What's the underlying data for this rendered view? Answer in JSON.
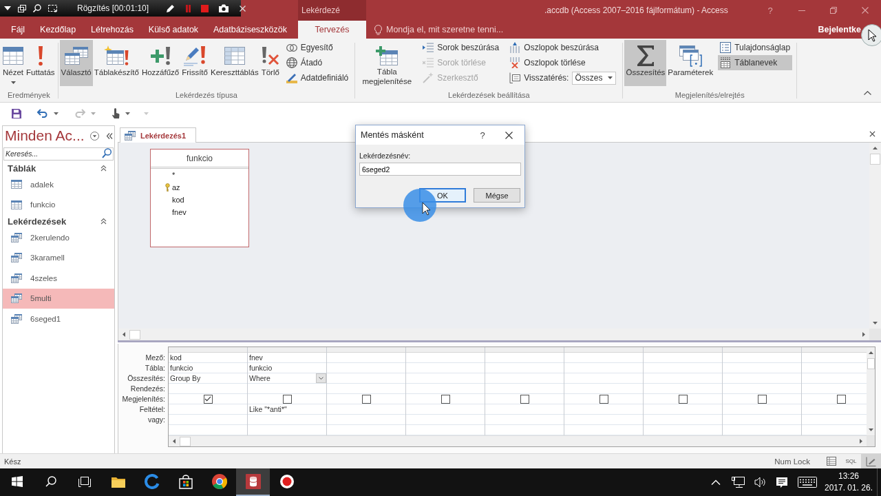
{
  "recorder_toolbar": {
    "status": "Rögzítés [00:01:10]"
  },
  "title_bar": {
    "title": ".accdb (Access 2007–2016 fájlformátum) - Access",
    "help": "?"
  },
  "ribbon_tabs": [
    {
      "label": "Fájl",
      "selected": false
    },
    {
      "label": "Kezdőlap",
      "selected": false
    },
    {
      "label": "Létrehozás",
      "selected": false
    },
    {
      "label": "Külső adatok",
      "selected": false
    },
    {
      "label": "Adatbáziseszközök",
      "selected": false
    }
  ],
  "context_group": {
    "label": "Lekérdezé",
    "tabs": [
      {
        "label": "Tervezés",
        "selected": true
      }
    ]
  },
  "tell_me": {
    "placeholder": "Mondja el, mit szeretne tenni..."
  },
  "account": "Bejelentke",
  "ribbon_groups": [
    {
      "label": "Eredmények",
      "buttons": [
        {
          "label": "Nézet",
          "selected": false,
          "dropdown": true
        },
        {
          "label": "Futtatás",
          "selected": false
        }
      ]
    },
    {
      "label": "Lekérdezés típusa",
      "buttons": [
        {
          "label": "Választó",
          "selected": true
        },
        {
          "label": "Táblakészítő",
          "selected": false
        },
        {
          "label": "Hozzáfűző",
          "selected": false
        },
        {
          "label": "Frissítő",
          "selected": false
        },
        {
          "label": "Kereszttáblás",
          "selected": false
        },
        {
          "label": "Törlő",
          "selected": false
        }
      ],
      "small_columns": [
        [
          {
            "kind": "button",
            "label": "Egyesítő"
          },
          {
            "kind": "button",
            "label": "Átadó"
          },
          {
            "kind": "button",
            "label": "Adatdefiniáló"
          }
        ]
      ]
    },
    {
      "label": "Lekérdezések beállítása",
      "buttons": [
        {
          "label": "Tábla megjelenítése",
          "selected": false
        }
      ],
      "small_columns": [
        [
          {
            "kind": "button",
            "label": "Sorok beszúrása",
            "disabled": false
          },
          {
            "kind": "button",
            "label": "Sorok törlése",
            "disabled": true
          },
          {
            "kind": "button",
            "label": "Szerkesztő",
            "disabled": true
          }
        ],
        [
          {
            "kind": "button",
            "label": "Oszlopok beszúrása",
            "disabled": false
          },
          {
            "kind": "button",
            "label": "Oszlopok törlése",
            "disabled": false
          },
          {
            "kind": "combo",
            "label": "Visszatérés:",
            "value": "Összes"
          }
        ]
      ]
    },
    {
      "label": "Megjelenítés/elrejtés",
      "buttons": [
        {
          "label": "Összesítés",
          "selected": true
        },
        {
          "label": "Paraméterek",
          "selected": false
        }
      ],
      "small_columns": [
        [
          {
            "kind": "button",
            "label": "Tulajdonságlap",
            "selected": false
          },
          {
            "kind": "button",
            "label": "Táblanevek",
            "selected": true
          }
        ]
      ]
    }
  ],
  "quick_access": [
    {
      "disabled": false
    },
    {
      "disabled": false
    },
    {
      "disabled": true
    },
    {
      "disabled": false
    }
  ],
  "nav_pane": {
    "title": "Minden Ac...",
    "search": {
      "placeholder": "Keresés..."
    },
    "groups": [
      {
        "label": "Táblák",
        "kind": "table",
        "expanded": true,
        "items": [
          {
            "label": "adalek",
            "selected": false
          },
          {
            "label": "funkcio",
            "selected": false
          }
        ]
      },
      {
        "label": "Lekérdezések",
        "kind": "query",
        "expanded": true,
        "items": [
          {
            "label": "2kerulendo",
            "selected": false
          },
          {
            "label": "3karamell",
            "selected": false
          },
          {
            "label": "4szeles",
            "selected": false
          },
          {
            "label": "5multi",
            "selected": true
          },
          {
            "label": "6seged1",
            "selected": false
          }
        ]
      }
    ]
  },
  "document_tabs": [
    {
      "label": "Lekérdezés1",
      "selected": true
    }
  ],
  "field_list": {
    "title": "funkcio",
    "fields": [
      {
        "label": "*",
        "primary_key": false
      },
      {
        "label": "az",
        "primary_key": true
      },
      {
        "label": "kod",
        "primary_key": false
      },
      {
        "label": "fnev",
        "primary_key": false
      }
    ]
  },
  "design_grid": {
    "row_labels": [
      "Mező:",
      "Tábla:",
      "Összesítés:",
      "Rendezés:",
      "Megjelenítés:",
      "Feltétel:",
      "vagy:"
    ],
    "columns": [
      {
        "field": "kod",
        "table": "funkcio",
        "total": "Group By",
        "show": true
      },
      {
        "field": "fnev",
        "table": "funkcio",
        "total": "Where",
        "total_dropdown": true,
        "show": false,
        "criteria": "Like \"*anti*\""
      },
      {
        "show": false
      },
      {
        "show": false
      },
      {
        "show": false
      },
      {
        "show": false
      },
      {
        "show": false
      },
      {
        "show": false
      },
      {
        "show": false
      }
    ]
  },
  "dialog": {
    "title": "Mentés másként",
    "help": "?",
    "field_label": "Lekérdezésnév:",
    "value": "6seged2",
    "buttons": [
      {
        "label": "OK",
        "default": true
      },
      {
        "label": "Mégse",
        "default": false
      }
    ]
  },
  "status_bar": {
    "text": "Kész",
    "indicator": "Num Lock",
    "views": [
      {
        "selected": false
      },
      {
        "label": "SQL",
        "selected": false
      },
      {
        "selected": true
      }
    ]
  },
  "taskbar": {
    "apps": [
      {
        "active": false
      },
      {
        "active": false
      },
      {
        "active": false
      },
      {
        "active": false
      },
      {
        "active": true
      },
      {
        "active": false
      }
    ],
    "clock": {
      "time": "13:26",
      "date": "2017. 01. 26."
    }
  }
}
